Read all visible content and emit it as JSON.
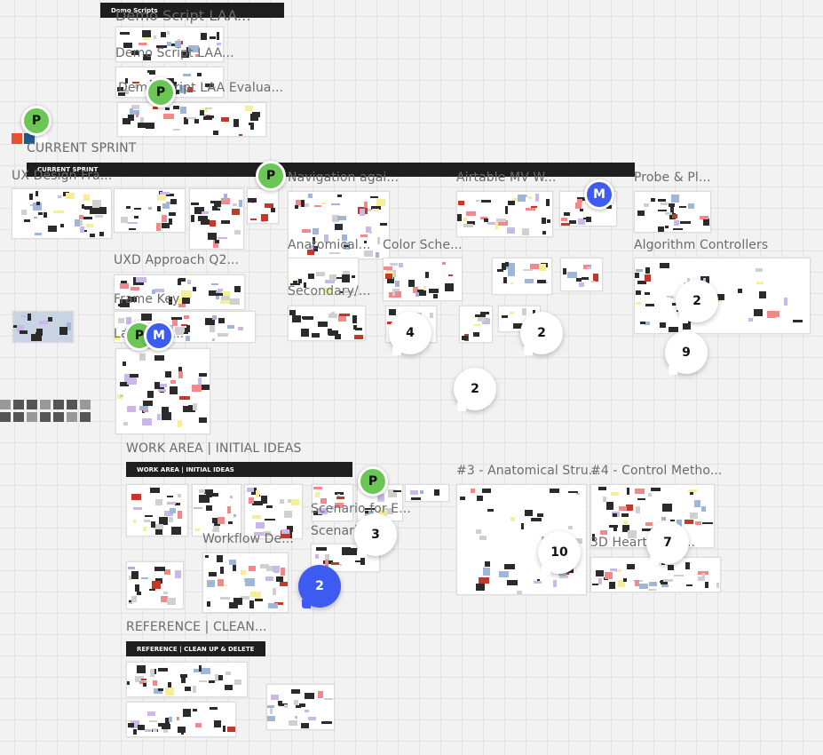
{
  "board": {
    "section_labels": [
      "Demo Script LAA...",
      "Demo Script LAA...",
      "Demo Script LAA Evalua...",
      "CURRENT SPRINT",
      "UX Design Fra...",
      "Navigation agai...",
      "Airtable MV W...",
      "Probe & Pl...",
      "Anatomical...",
      "Color Sche...",
      "Algorithm Controllers",
      "UXD Approach Q2...",
      "Frame Key",
      "Secondary/...",
      "La... ...Ac...",
      "WORK AREA | INITIAL IDEAS",
      "Scenario for E...",
      "Scenario...",
      "Workflow De...",
      "#3 - Anatomical Stru...",
      "#4 - Control Metho...",
      "3D Heart ...lati...",
      "REFERENCE | CLEAN..."
    ],
    "header_bars": [
      {
        "title": "Demo Scripts"
      },
      {
        "title": "CURRENT SPRINT"
      },
      {
        "title": "WORK AREA | INITIAL IDEAS"
      },
      {
        "title": "REFERENCE | CLEAN UP & DELETE"
      }
    ],
    "collaborators": [
      {
        "initial": "P",
        "color": "#6cc655"
      },
      {
        "initial": "P",
        "color": "#6cc655"
      },
      {
        "initial": "P",
        "color": "#6cc655"
      },
      {
        "initial": "P",
        "color": "#6cc655"
      },
      {
        "initial": "M",
        "color": "#3d5af1"
      },
      {
        "initial": "M",
        "color": "#3d5af1"
      },
      {
        "initial": "P",
        "color": "#6cc655"
      }
    ],
    "comment_counts": [
      {
        "count": "4",
        "highlighted": false
      },
      {
        "count": "2",
        "highlighted": false
      },
      {
        "count": "2",
        "highlighted": false
      },
      {
        "count": "2",
        "highlighted": false
      },
      {
        "count": "9",
        "highlighted": false
      },
      {
        "count": "3",
        "highlighted": false
      },
      {
        "count": "10",
        "highlighted": false
      },
      {
        "count": "7",
        "highlighted": false
      },
      {
        "count": "2",
        "highlighted": true
      }
    ],
    "colors": {
      "canvas": "#f2f2f2",
      "grid": "#e3e3e3",
      "bar": "#1e1e1e",
      "accent_red": "#c0392b",
      "highlight_bubble": "#3d5af1"
    }
  }
}
